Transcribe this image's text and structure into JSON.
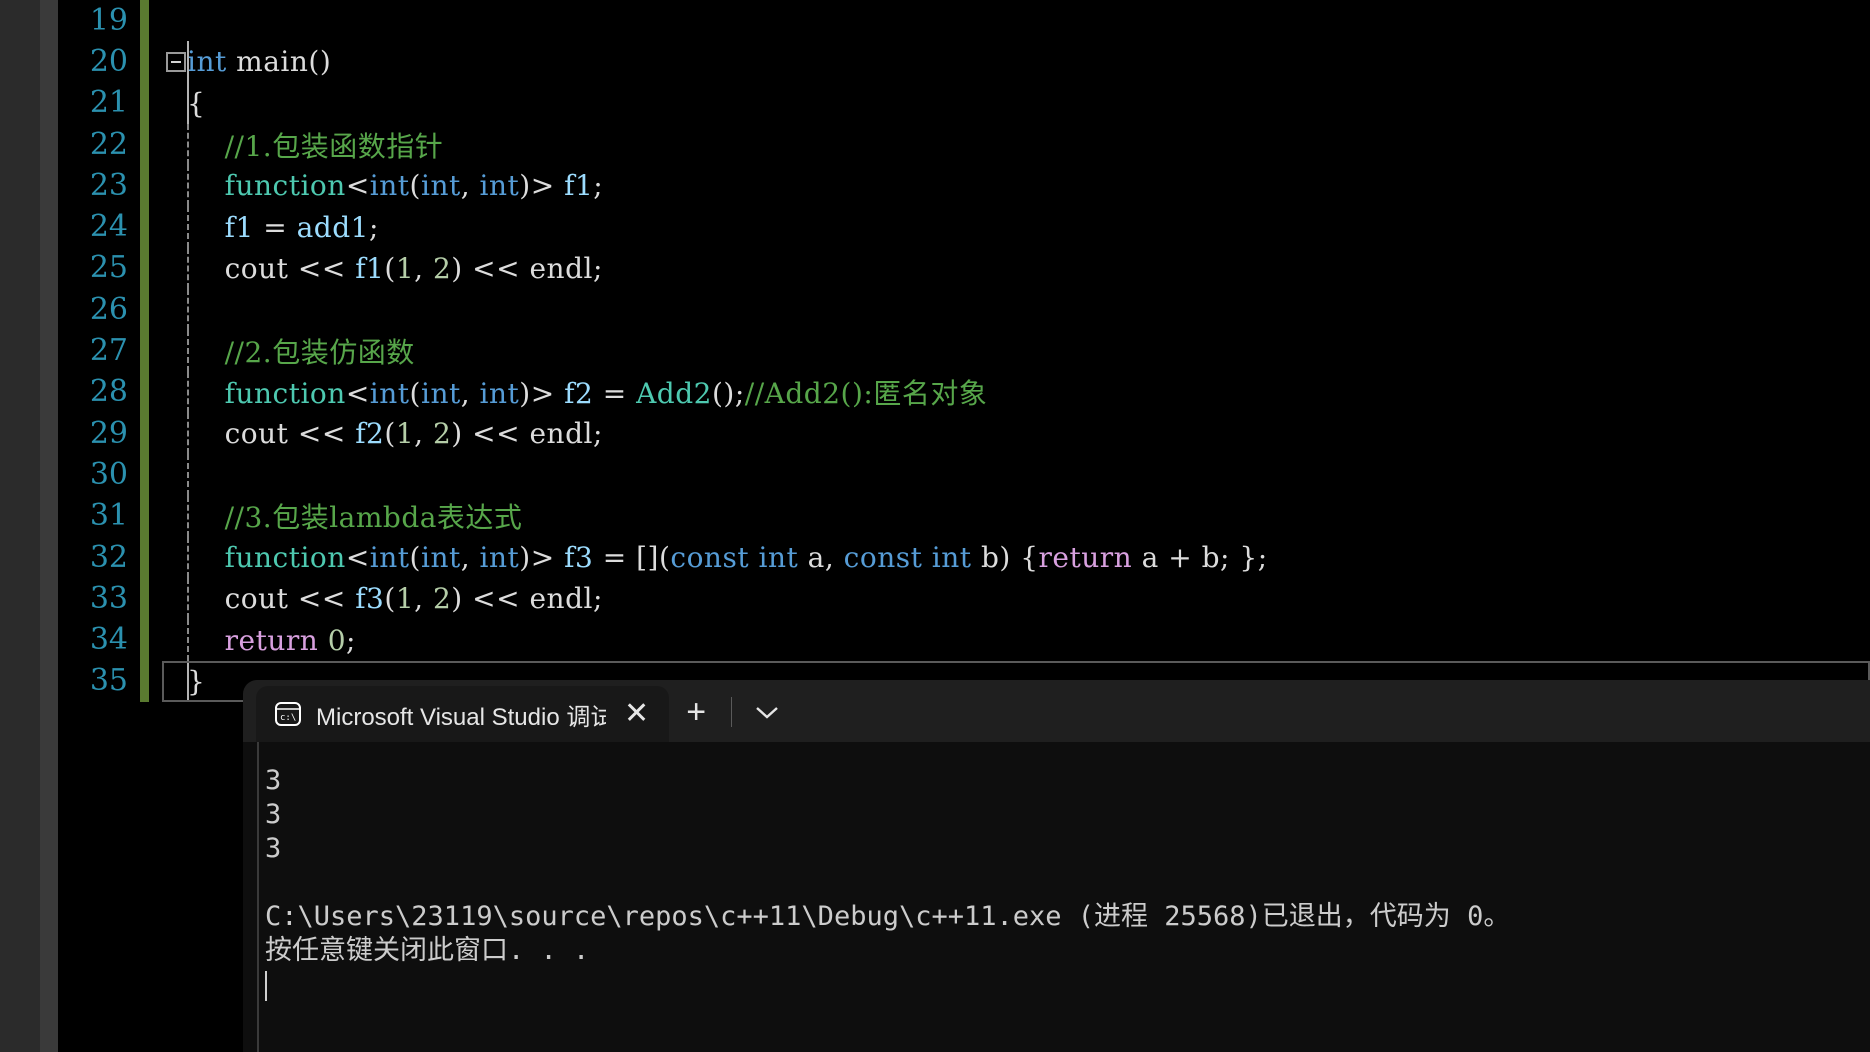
{
  "app": {
    "name": "Visual Studio Code Editor with Terminal",
    "theme": "dark"
  },
  "colors": {
    "editor_background": "#000000",
    "line_number": "#2b91af",
    "comment": "#57a64a",
    "keyword": "#569cd6",
    "type": "#4ec9b0",
    "control": "#d8a0df",
    "number": "#b5cea8",
    "variable": "#9cdcfe",
    "change_bar": "#5a7a30",
    "terminal_background": "#0e0e0e",
    "panel_background": "#1f1f1f",
    "tab_background": "#181818"
  },
  "editor": {
    "first_visible_line": 19,
    "last_visible_line": 35,
    "current_line": 35,
    "lines": [
      {
        "number": "19",
        "modified": true,
        "indent": 0,
        "text": ""
      },
      {
        "number": "20",
        "modified": true,
        "indent": 0,
        "text": "int main()",
        "fold": true,
        "vbar": true
      },
      {
        "number": "21",
        "modified": true,
        "indent": 0,
        "text": "{",
        "vbar": true
      },
      {
        "number": "22",
        "modified": true,
        "indent": 1,
        "text": "//1.包装函数指针",
        "dash": true
      },
      {
        "number": "23",
        "modified": true,
        "indent": 1,
        "text": "function<int(int, int)> f1;",
        "dash": true
      },
      {
        "number": "24",
        "modified": true,
        "indent": 1,
        "text": "f1 = add1;",
        "dash": true
      },
      {
        "number": "25",
        "modified": true,
        "indent": 1,
        "text": "cout << f1(1, 2) << endl;",
        "dash": true
      },
      {
        "number": "26",
        "modified": true,
        "indent": 1,
        "text": "",
        "dash": true
      },
      {
        "number": "27",
        "modified": true,
        "indent": 1,
        "text": "//2.包装仿函数",
        "dash": true
      },
      {
        "number": "28",
        "modified": true,
        "indent": 1,
        "text": "function<int(int, int)> f2 = Add2();//Add2():匿名对象",
        "dash": true
      },
      {
        "number": "29",
        "modified": true,
        "indent": 1,
        "text": "cout << f2(1, 2) << endl;",
        "dash": true
      },
      {
        "number": "30",
        "modified": true,
        "indent": 1,
        "text": "",
        "dash": true
      },
      {
        "number": "31",
        "modified": true,
        "indent": 1,
        "text": "//3.包装lambda表达式",
        "dash": true
      },
      {
        "number": "32",
        "modified": true,
        "indent": 1,
        "text": "function<int(int, int)> f3 = [](const int a, const int b) {return a + b; };",
        "dash": true
      },
      {
        "number": "33",
        "modified": true,
        "indent": 1,
        "text": "cout << f3(1, 2) << endl;",
        "dash": true
      },
      {
        "number": "34",
        "modified": true,
        "indent": 1,
        "text": "return 0;",
        "dash": true
      },
      {
        "number": "35",
        "modified": true,
        "indent": 0,
        "text": "}",
        "vbar": true,
        "current": true
      }
    ]
  },
  "terminal": {
    "tab": {
      "icon": "command-prompt-icon",
      "label": "Microsoft Visual Studio 调试控",
      "close_label": "✕"
    },
    "actions": {
      "new_label": "+",
      "dropdown_label": "⌄"
    },
    "output_lines": [
      "3",
      "3",
      "3",
      "",
      "C:\\Users\\23119\\source\\repos\\c++11\\Debug\\c++11.exe (进程 25568)已退出，代码为 0。",
      "按任意键关闭此窗口. . ."
    ]
  }
}
